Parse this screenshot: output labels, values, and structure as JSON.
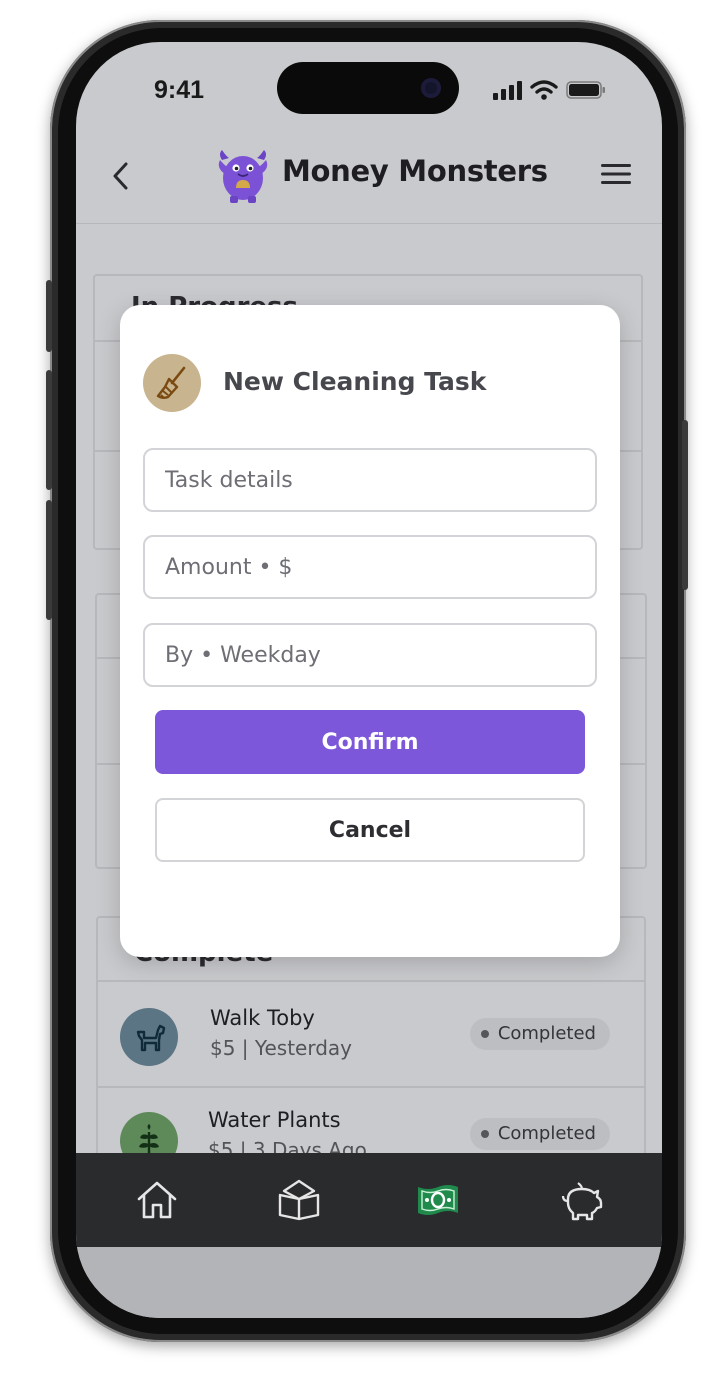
{
  "status_bar": {
    "time": "9:41"
  },
  "header": {
    "title": "Money Monsters"
  },
  "background": {
    "in_progress_title": "In Progress",
    "complete_title": "Complete",
    "completed_tasks": [
      {
        "name": "Walk Toby",
        "meta": "$5 | Yesterday",
        "status": "Completed",
        "icon": "dog-icon",
        "color": "#5b7584"
      },
      {
        "name": "Water Plants",
        "meta": "$5 | 3 Days Ago",
        "status": "Completed",
        "icon": "plant-icon",
        "color": "#5e8a5a"
      }
    ]
  },
  "modal": {
    "title": "New Cleaning Task",
    "icon": "broom-icon",
    "task_placeholder": "Task details",
    "amount_placeholder": "Amount • $",
    "by_placeholder": "By • Weekday",
    "confirm_label": "Confirm",
    "cancel_label": "Cancel"
  },
  "bottom_nav": {
    "items": [
      {
        "icon": "home-icon"
      },
      {
        "icon": "learn-book-icon"
      },
      {
        "icon": "money-icon",
        "active_color": "#1f8a4c"
      },
      {
        "icon": "piggy-bank-icon"
      }
    ]
  },
  "colors": {
    "accent": "#7c57d9",
    "modal_icon_bg": "#c8b48e"
  }
}
